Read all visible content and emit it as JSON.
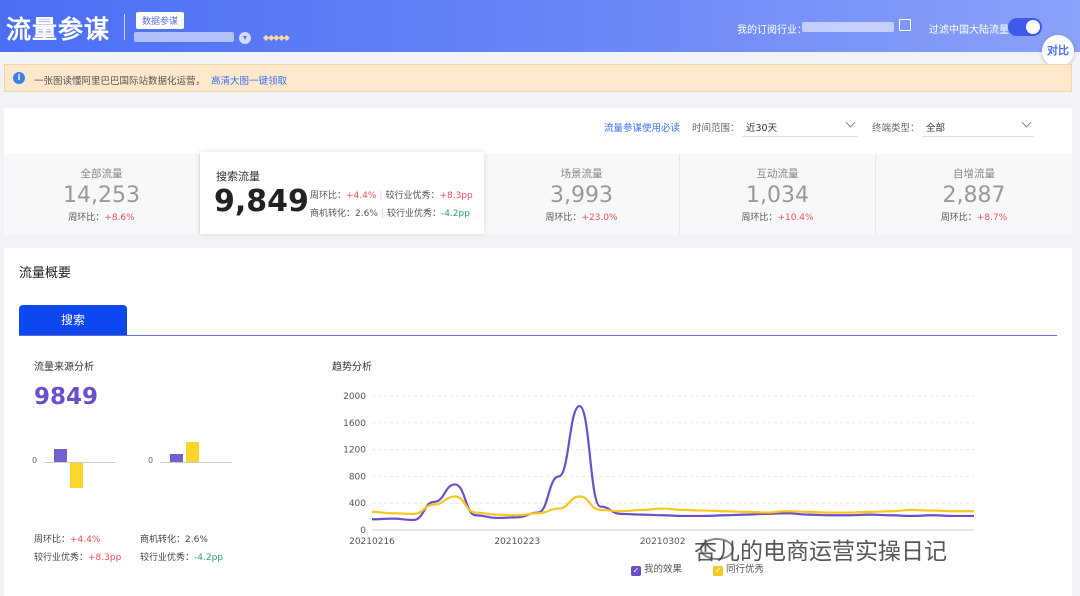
{
  "header": {
    "logo": "流量参谋",
    "badge": "数据参谋",
    "industry_label": "我的订阅行业：",
    "filter_label": "过滤中国大陆流量",
    "compare_label": "对比"
  },
  "notice": {
    "text": "一张图读懂阿里巴巴国际站数据化运营，",
    "link": "高清大图一键领取"
  },
  "filters": {
    "guide_link": "流量参谋使用必读",
    "time_label": "时间范围：",
    "time_value": "近30天",
    "device_label": "终端类型：",
    "device_value": "全部"
  },
  "metrics": [
    {
      "name": "全部流量",
      "value": "14,253",
      "change_label": "周环比：",
      "change": "+8.6%"
    },
    {
      "name": "场景流量",
      "value": "3,993",
      "change_label": "周环比：",
      "change": "+23.0%"
    },
    {
      "name": "互动流量",
      "value": "1,034",
      "change_label": "周环比：",
      "change": "+10.4%"
    },
    {
      "name": "自增流量",
      "value": "2,887",
      "change_label": "周环比：",
      "change": "+8.7%"
    }
  ],
  "active_metric": {
    "name": "搜索流量",
    "value": "9,849",
    "wow_label": "周环比：",
    "wow": "+4.4%",
    "ind1_label": "较行业优秀：",
    "ind1": "+8.3pp",
    "conv_label": "商机转化：",
    "conv": "2.6%",
    "ind2_label": "较行业优秀：",
    "ind2": "-4.2pp"
  },
  "overview": {
    "title": "流量概要",
    "tab": "搜索",
    "source_title": "流量来源分析",
    "source_value": "9849",
    "zero": "0",
    "stats": {
      "wow_label": "周环比：",
      "wow": "+4.4%",
      "conv_label": "商机转化：",
      "conv": "2.6%",
      "ind1_label": "较行业优秀：",
      "ind1": "+8.3pp",
      "ind2_label": "较行业优秀：",
      "ind2": "-4.2pp"
    },
    "mini_bars": [
      {
        "purple": 4.4,
        "yellow": -8.3
      },
      {
        "purple": 2.6,
        "yellow": 6.8
      }
    ],
    "trend_title": "趋势分析"
  },
  "chart_data": {
    "type": "line",
    "x": [
      "20210216",
      "20210217",
      "20210218",
      "20210219",
      "20210220",
      "20210221",
      "20210222",
      "20210223",
      "20210224",
      "20210225",
      "20210226",
      "20210227",
      "20210228",
      "20210301",
      "20210302",
      "20210303",
      "20210304",
      "20210305",
      "20210306",
      "20210307",
      "20210308",
      "20210309",
      "20210310",
      "20210311",
      "20210312",
      "20210313",
      "20210314",
      "20210315",
      "20210316",
      "20210317"
    ],
    "x_tick_labels": [
      "20210216",
      "20210223",
      "20210302"
    ],
    "yticks": [
      0,
      400,
      800,
      1200,
      1600,
      2000
    ],
    "ylim": [
      0,
      2000
    ],
    "series": [
      {
        "name": "我的效果",
        "color": "#6a4fc9",
        "values": [
          160,
          170,
          150,
          420,
          680,
          220,
          180,
          190,
          260,
          800,
          1850,
          350,
          240,
          230,
          220,
          210,
          210,
          220,
          230,
          240,
          250,
          230,
          220,
          220,
          230,
          220,
          210,
          220,
          210,
          210
        ]
      },
      {
        "name": "同行优秀",
        "color": "#f7c71f",
        "values": [
          270,
          250,
          240,
          380,
          500,
          260,
          230,
          220,
          250,
          320,
          500,
          300,
          280,
          300,
          320,
          300,
          290,
          280,
          270,
          260,
          280,
          270,
          260,
          260,
          270,
          280,
          300,
          290,
          280,
          280
        ]
      }
    ],
    "legend_position": "bottom"
  },
  "watermark": "杏儿的电商运营实操日记"
}
